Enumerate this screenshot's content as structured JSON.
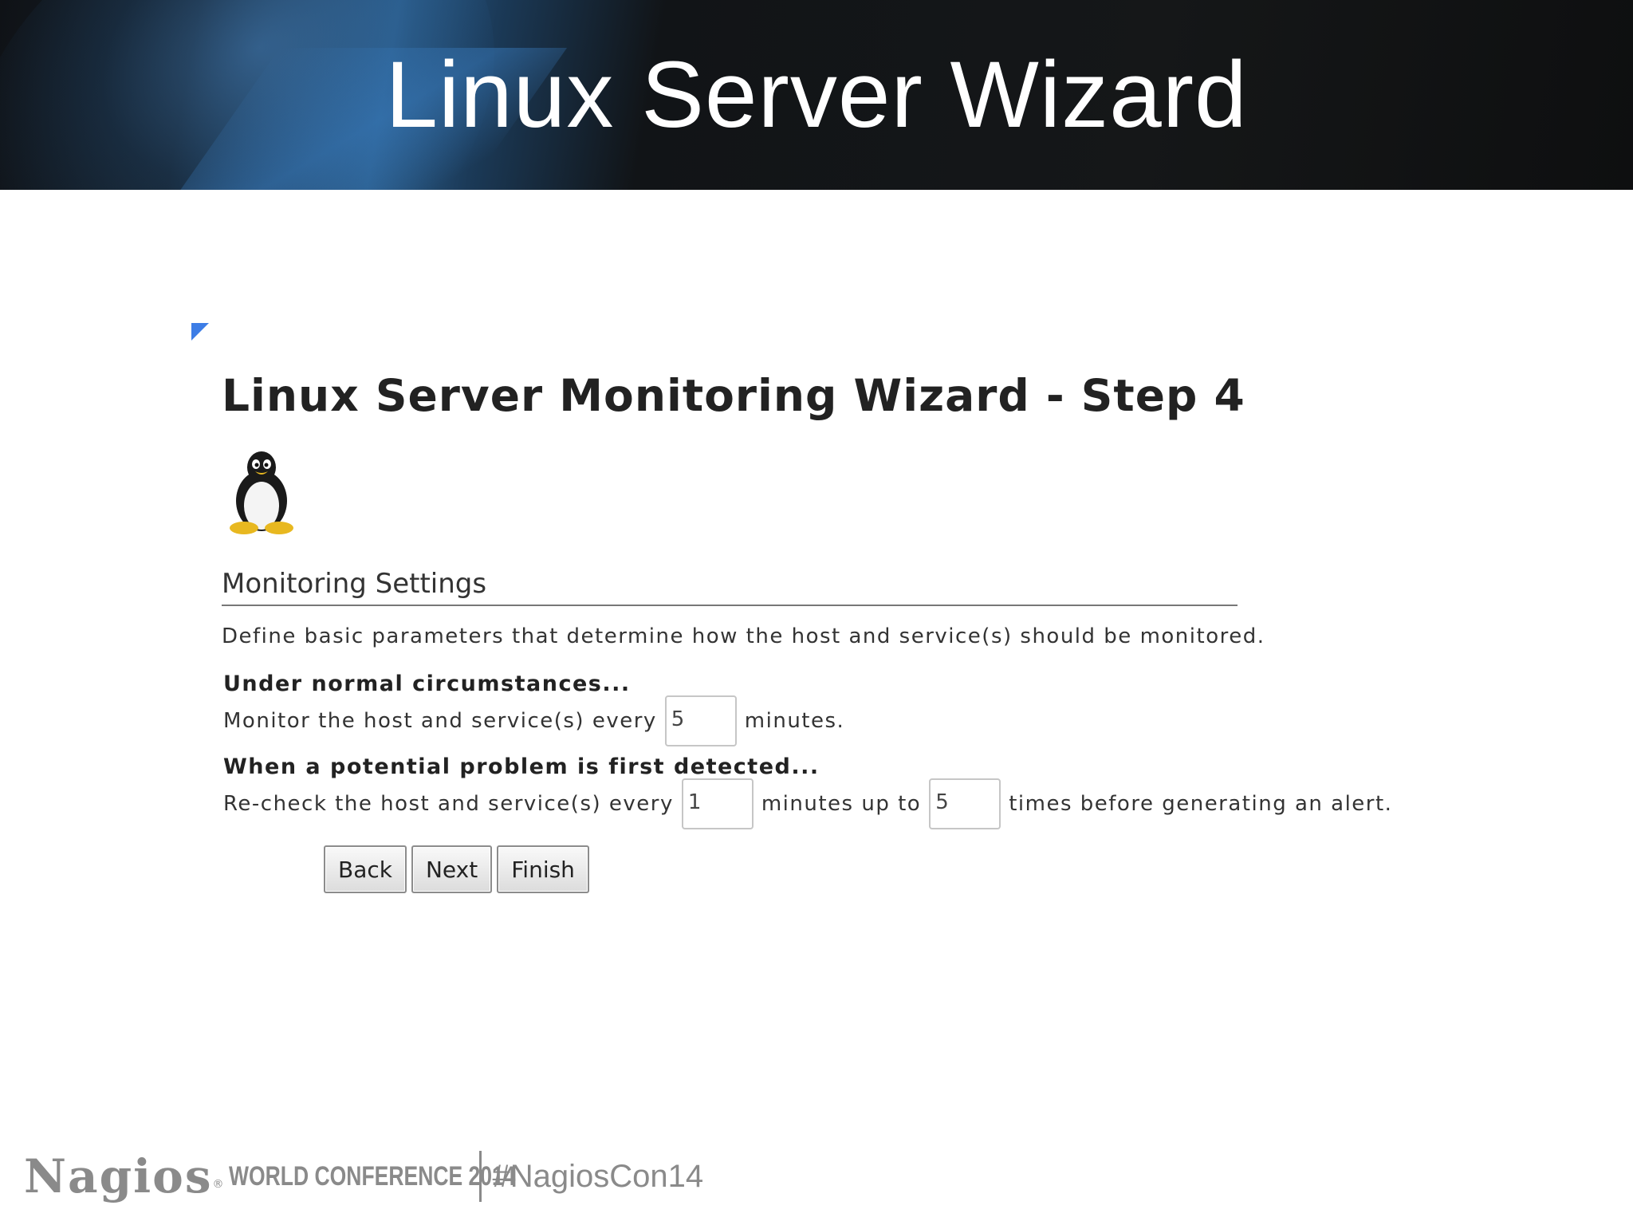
{
  "slide": {
    "title": "Linux Server Wizard"
  },
  "wizard": {
    "title": "Linux Server Monitoring Wizard - Step 4",
    "section_title": "Monitoring Settings",
    "description": "Define basic parameters that determine how the host and service(s) should be monitored.",
    "normal": {
      "heading": "Under normal circumstances...",
      "prefix": "Monitor the host and service(s) every",
      "interval_value": "5",
      "suffix": "minutes."
    },
    "problem": {
      "heading": "When a potential problem is first detected...",
      "prefix": "Re-check the host and service(s) every",
      "retry_value": "1",
      "middle": "minutes up to",
      "attempts_value": "5",
      "suffix": "times before generating an alert."
    },
    "buttons": {
      "back": "Back",
      "next": "Next",
      "finish": "Finish"
    }
  },
  "footer": {
    "logo": "Nagios",
    "registered": "®",
    "conference": "WORLD CONFERENCE 2014",
    "hashtag": "#NagiosCon14"
  },
  "colors": {
    "collapse_icon": "#3d7de6",
    "banner_bg": "#141618",
    "footer_text": "#8a8a8a"
  },
  "icons": {
    "collapse": "collapse-triangle-icon",
    "tux": "tux-penguin-icon"
  }
}
